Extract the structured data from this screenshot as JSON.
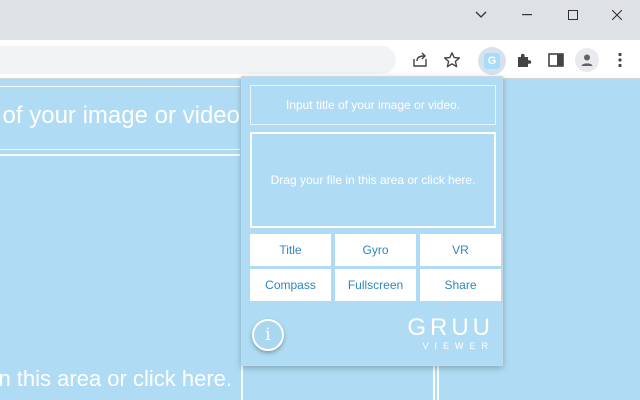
{
  "window_controls": {
    "dropdown_glyph": "⌄",
    "minimize_glyph": "—",
    "maximize_glyph": "☐",
    "close_glyph": "✕"
  },
  "toolbar_icons": [
    "share-icon",
    "bookmark-star-icon",
    "gruu-extension-icon",
    "extensions-puzzle-icon",
    "side-panel-icon",
    "profile-icon",
    "menu-kebab-icon"
  ],
  "extension_badge": "G",
  "page": {
    "title_text": "Input title of your image or video.",
    "drop_text": "Drag your file in this area or click here."
  },
  "popup": {
    "title_placeholder": "Input title of your image or video.",
    "drop_text": "Drag your file in this area or click here.",
    "buttons": [
      "Title",
      "Gyro",
      "VR",
      "Compass",
      "Fullscreen",
      "Share"
    ],
    "info_label": "i",
    "logo_main": "GRUU",
    "logo_sub": "VIEWER"
  },
  "colors": {
    "background": "#afdcf4",
    "button_text": "#2f86bf",
    "chrome_bar": "#dee1e6"
  }
}
